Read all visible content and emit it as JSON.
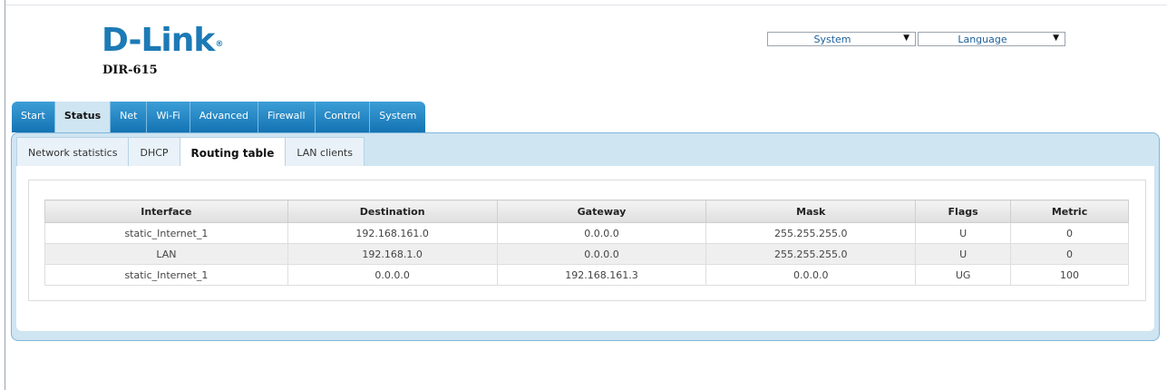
{
  "brand": {
    "logo_text": "D-Link",
    "logo_mark": "®",
    "model": "DIR-615"
  },
  "header": {
    "system_select": {
      "value": "System"
    },
    "language_select": {
      "value": "Language"
    }
  },
  "main_tabs": [
    {
      "label": "Start",
      "active": false
    },
    {
      "label": "Status",
      "active": true
    },
    {
      "label": "Net",
      "active": false
    },
    {
      "label": "Wi-Fi",
      "active": false
    },
    {
      "label": "Advanced",
      "active": false
    },
    {
      "label": "Firewall",
      "active": false
    },
    {
      "label": "Control",
      "active": false
    },
    {
      "label": "System",
      "active": false
    }
  ],
  "sub_tabs": [
    {
      "label": "Network statistics",
      "active": false
    },
    {
      "label": "DHCP",
      "active": false
    },
    {
      "label": "Routing table",
      "active": true
    },
    {
      "label": "LAN clients",
      "active": false
    }
  ],
  "routing_table": {
    "columns": [
      "Interface",
      "Destination",
      "Gateway",
      "Mask",
      "Flags",
      "Metric"
    ],
    "rows": [
      [
        "static_Internet_1",
        "192.168.161.0",
        "0.0.0.0",
        "255.255.255.0",
        "U",
        "0"
      ],
      [
        "LAN",
        "192.168.1.0",
        "0.0.0.0",
        "255.255.255.0",
        "U",
        "0"
      ],
      [
        "static_Internet_1",
        "0.0.0.0",
        "192.168.161.3",
        "0.0.0.0",
        "UG",
        "100"
      ]
    ]
  }
}
